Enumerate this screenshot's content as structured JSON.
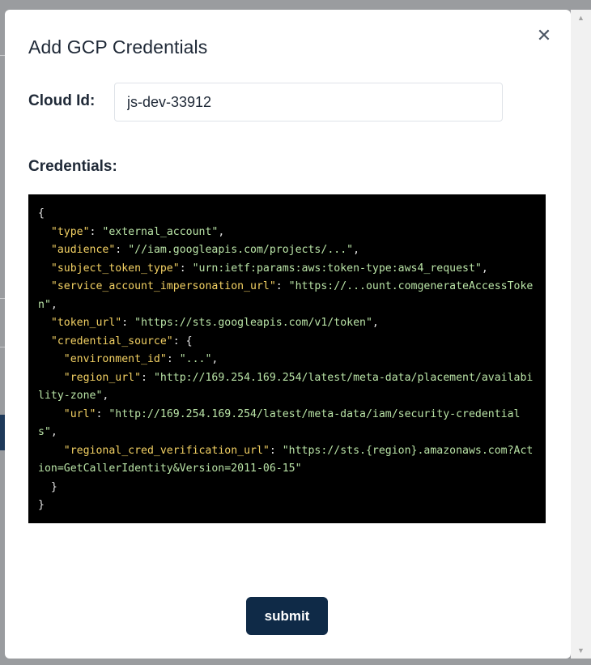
{
  "modal": {
    "title": "Add GCP Credentials",
    "close_glyph": "✕",
    "cloud_id_label": "Cloud Id:",
    "cloud_id_value": "js-dev-33912",
    "credentials_label": "Credentials:",
    "submit_label": "submit"
  },
  "credentials_json": [
    [
      {
        "t": "p",
        "v": "{"
      }
    ],
    [
      {
        "t": "p",
        "v": "  "
      },
      {
        "t": "k",
        "v": "\"type\""
      },
      {
        "t": "p",
        "v": ": "
      },
      {
        "t": "s",
        "v": "\"external_account\""
      },
      {
        "t": "p",
        "v": ","
      }
    ],
    [
      {
        "t": "p",
        "v": "  "
      },
      {
        "t": "k",
        "v": "\"audience\""
      },
      {
        "t": "p",
        "v": ": "
      },
      {
        "t": "s",
        "v": "\"//iam.googleapis.com/projects/...\""
      },
      {
        "t": "p",
        "v": ","
      }
    ],
    [
      {
        "t": "p",
        "v": "  "
      },
      {
        "t": "k",
        "v": "\"subject_token_type\""
      },
      {
        "t": "p",
        "v": ": "
      },
      {
        "t": "s",
        "v": "\"urn:ietf:params:aws:token-type:aws4_request\""
      },
      {
        "t": "p",
        "v": ","
      }
    ],
    [
      {
        "t": "p",
        "v": "  "
      },
      {
        "t": "k",
        "v": "\"service_account_impersonation_url\""
      },
      {
        "t": "p",
        "v": ": "
      },
      {
        "t": "s",
        "v": "\"https://...ount.comgenerateAccessToken\""
      },
      {
        "t": "p",
        "v": ","
      }
    ],
    [
      {
        "t": "p",
        "v": "  "
      },
      {
        "t": "k",
        "v": "\"token_url\""
      },
      {
        "t": "p",
        "v": ": "
      },
      {
        "t": "s",
        "v": "\"https://sts.googleapis.com/v1/token\""
      },
      {
        "t": "p",
        "v": ","
      }
    ],
    [
      {
        "t": "p",
        "v": "  "
      },
      {
        "t": "k",
        "v": "\"credential_source\""
      },
      {
        "t": "p",
        "v": ": {"
      }
    ],
    [
      {
        "t": "p",
        "v": "    "
      },
      {
        "t": "k",
        "v": "\"environment_id\""
      },
      {
        "t": "p",
        "v": ": "
      },
      {
        "t": "s",
        "v": "\"...\""
      },
      {
        "t": "p",
        "v": ","
      }
    ],
    [
      {
        "t": "p",
        "v": "    "
      },
      {
        "t": "k",
        "v": "\"region_url\""
      },
      {
        "t": "p",
        "v": ": "
      },
      {
        "t": "s",
        "v": "\"http://169.254.169.254/latest/meta-data/placement/availability-zone\""
      },
      {
        "t": "p",
        "v": ","
      }
    ],
    [
      {
        "t": "p",
        "v": "    "
      },
      {
        "t": "k",
        "v": "\"url\""
      },
      {
        "t": "p",
        "v": ": "
      },
      {
        "t": "s",
        "v": "\"http://169.254.169.254/latest/meta-data/iam/security-credentials\""
      },
      {
        "t": "p",
        "v": ","
      }
    ],
    [
      {
        "t": "p",
        "v": "    "
      },
      {
        "t": "k",
        "v": "\"regional_cred_verification_url\""
      },
      {
        "t": "p",
        "v": ": "
      },
      {
        "t": "s",
        "v": "\"https://sts.{region}.amazonaws.com?Action=GetCallerIdentity&Version=2011-06-15\""
      }
    ],
    [
      {
        "t": "p",
        "v": "  }"
      }
    ],
    [
      {
        "t": "p",
        "v": "}"
      }
    ]
  ],
  "colors": {
    "code_background": "#000000",
    "code_key": "#f3d163",
    "code_string": "#b9e3a6",
    "submit_background": "#0f2a47",
    "backdrop": "#9a9c9f"
  }
}
